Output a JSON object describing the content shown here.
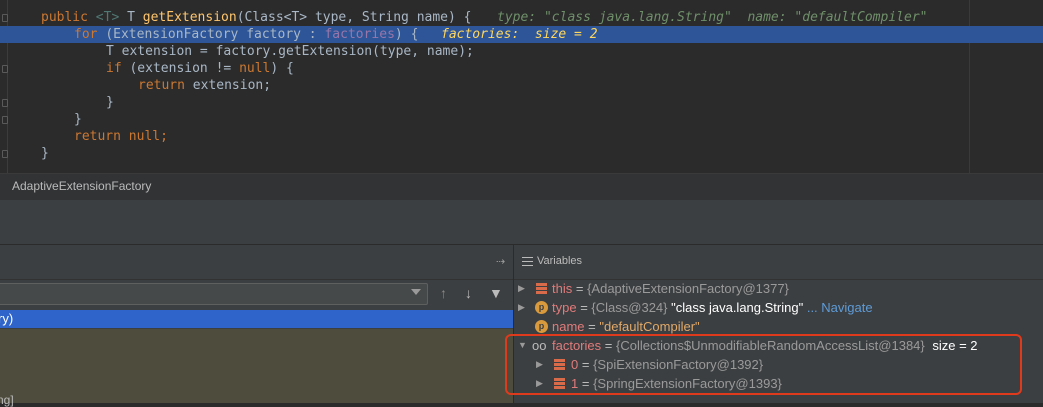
{
  "editor": {
    "line1": {
      "kw_public": "public",
      "generic": "<T>",
      "return_type": "T",
      "method": "getExtension",
      "params": "(Class<T> type, String name) {",
      "hint": "type: \"class java.lang.String\"  name: \"defaultCompiler\""
    },
    "line2": {
      "kw_for": "for",
      "body": "(ExtensionFactory factory : ",
      "field": "factories",
      "close": ") {",
      "hint": "factories:  size = 2"
    },
    "line3": "T extension = factory.getExtension(type, name);",
    "line4": {
      "kw_if": "if",
      "body": "(extension != ",
      "kw_null": "null",
      "close": ") {"
    },
    "line5": {
      "kw_return": "return",
      "body": " extension;"
    },
    "line6": "}",
    "line7": "}",
    "line8": {
      "kw_return": "return",
      "kw_null": "null",
      "semi": ";"
    },
    "line9": "}"
  },
  "breadcrumb": {
    "label": "AdaptiveExtensionFactory"
  },
  "frames_panel": {
    "restore_icon": "restore-layout-icon",
    "thread_select": "",
    "selected_frame": "ry)",
    "lower_frame_fragment": "ng]"
  },
  "variables_panel": {
    "title": "Variables",
    "rows": [
      {
        "name": "this",
        "value": "{AdaptiveExtensionFactory@1377}",
        "icon": "field-icon"
      },
      {
        "name": "type",
        "value": "{Class@324}",
        "string": "\"class java.lang.String\"",
        "more": "...",
        "link": "Navigate",
        "icon": "parameter-icon"
      },
      {
        "name": "name",
        "string": "\"defaultCompiler\"",
        "icon": "parameter-icon"
      },
      {
        "name": "factories",
        "value": "{Collections$UnmodifiableRandomAccessList@1384}",
        "size": "size = 2",
        "icon": "watch-icon"
      },
      {
        "name": "0",
        "value": "{SpiExtensionFactory@1392}",
        "icon": "field-icon"
      },
      {
        "name": "1",
        "value": "{SpringExtensionFactory@1393}",
        "icon": "field-icon"
      }
    ]
  },
  "colors": {
    "highlight_line": "#2d5597",
    "selected_frame": "#2f65ca",
    "annotation_box": "#e03a1c"
  }
}
